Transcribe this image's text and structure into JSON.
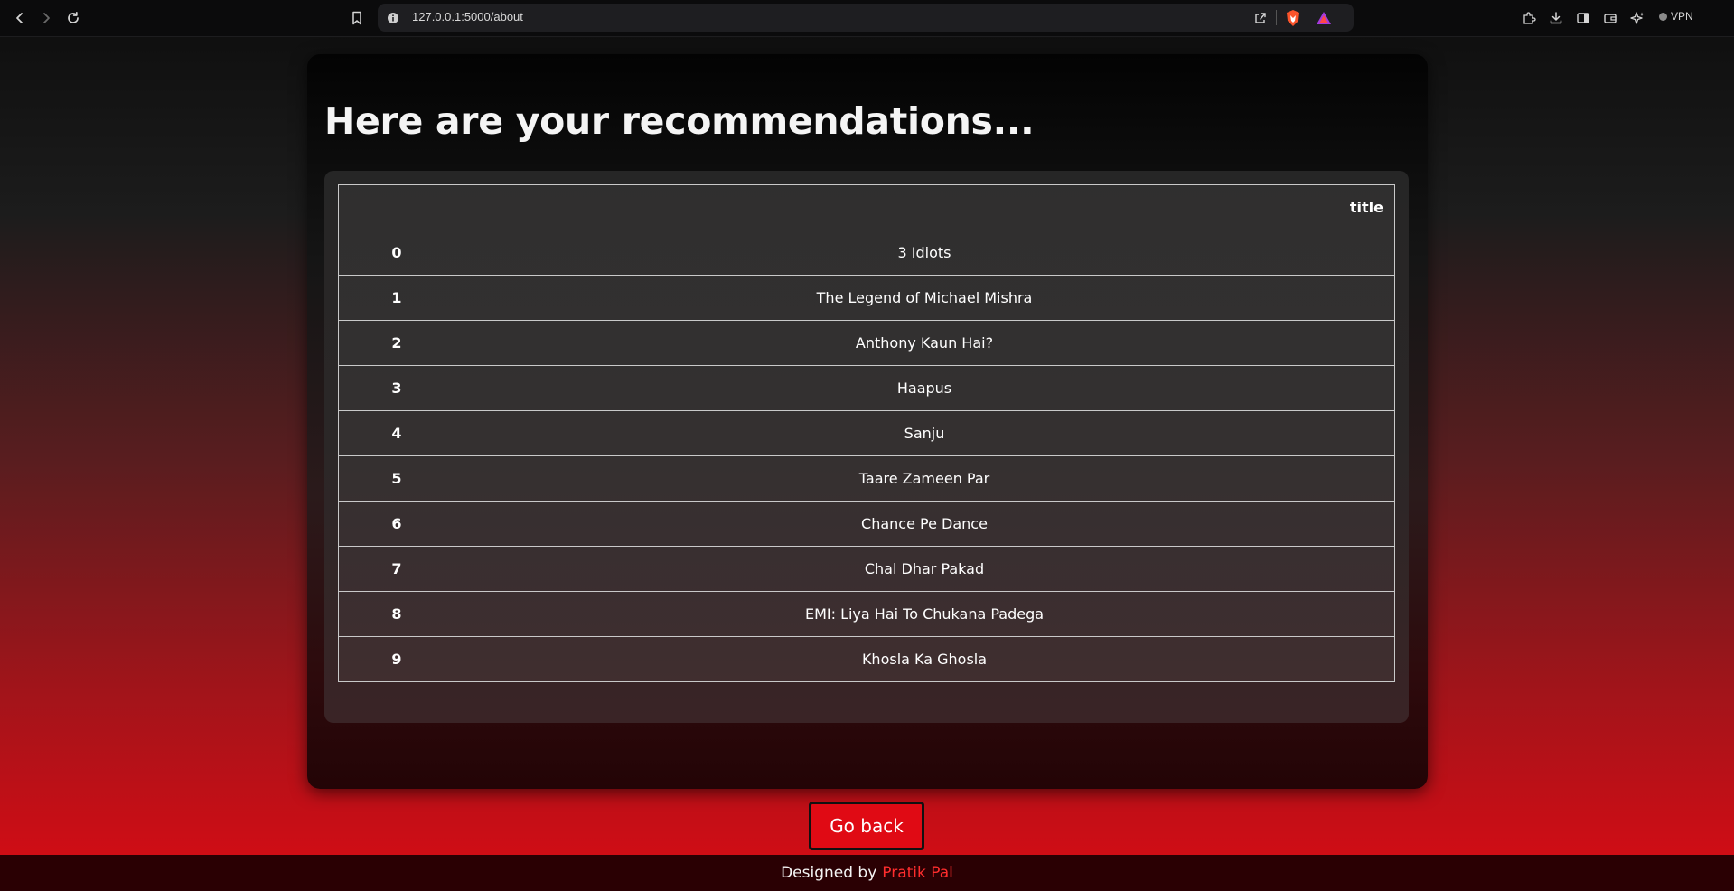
{
  "browser": {
    "url": "127.0.0.1:5000/about",
    "vpn_label": "VPN",
    "icons": [
      "back-icon",
      "forward-icon",
      "reload-icon",
      "bookmark-icon",
      "site-info-icon",
      "share-icon",
      "brave-shield-icon",
      "brave-rewards-icon",
      "extensions-icon",
      "download-icon",
      "sidebar-icon",
      "wallet-icon",
      "leo-ai-icon",
      "vpn-icon"
    ]
  },
  "page": {
    "heading": "Here are your recommendations...",
    "table": {
      "columns": [
        "",
        "title"
      ],
      "rows": [
        {
          "index": "0",
          "title": "3 Idiots"
        },
        {
          "index": "1",
          "title": "The Legend of Michael Mishra"
        },
        {
          "index": "2",
          "title": "Anthony Kaun Hai?"
        },
        {
          "index": "3",
          "title": "Haapus"
        },
        {
          "index": "4",
          "title": "Sanju"
        },
        {
          "index": "5",
          "title": "Taare Zameen Par"
        },
        {
          "index": "6",
          "title": "Chance Pe Dance"
        },
        {
          "index": "7",
          "title": "Chal Dhar Pakad"
        },
        {
          "index": "8",
          "title": "EMI: Liya Hai To Chukana Padega"
        },
        {
          "index": "9",
          "title": "Khosla Ka Ghosla"
        }
      ]
    },
    "go_back_label": "Go back"
  },
  "footer": {
    "prefix": "Designed by",
    "author": "Pratik Pal"
  },
  "colors": {
    "accent_red": "#e00a14",
    "author_red": "#ff2d2d",
    "footer_bg": "#2a0003"
  }
}
